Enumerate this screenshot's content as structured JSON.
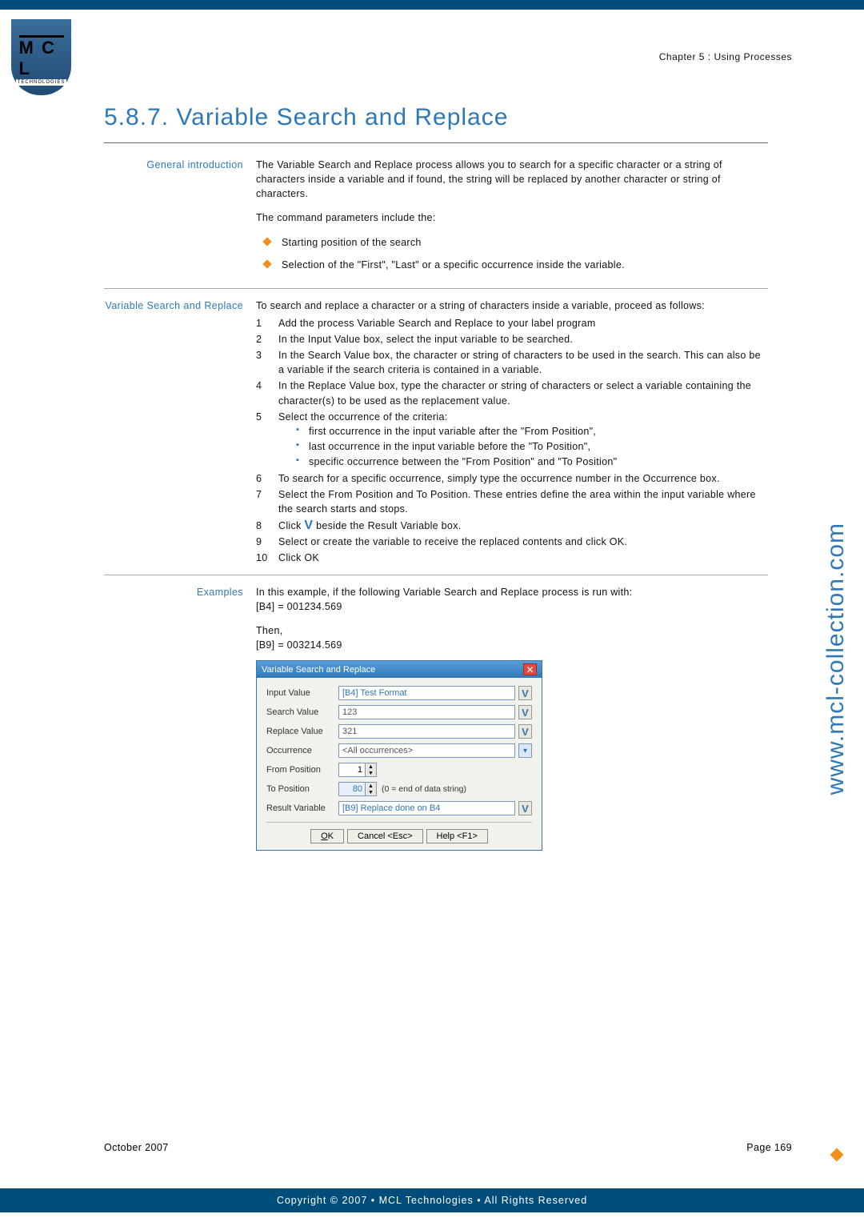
{
  "chapter": "Chapter 5 : Using Processes",
  "heading": "5.8.7.    Variable Search and Replace",
  "sections": {
    "intro": {
      "label": "General introduction",
      "p1": "The Variable Search and Replace process allows you to search for a specific character or a string of characters inside a variable and if found, the string will be replaced by another character or string of characters.",
      "p2": "The command parameters include the:",
      "bullets": [
        "Starting position of the search",
        "Selection of the \"First\", \"Last\" or a specific occurrence inside the variable."
      ]
    },
    "proc": {
      "label": "Variable Search and Replace",
      "lead": "To search and replace a character or a string of characters inside a variable, proceed as follows:",
      "steps": [
        "Add the process Variable Search and Replace to your label program",
        "In the Input Value box, select the input variable to be searched.",
        "In the Search Value box, the character or string of characters to be used in the search. This can also be a variable if the search criteria is contained in a variable.",
        "In the Replace Value box, type the character or string of characters or select a variable containing the character(s) to be used as the replacement value.",
        "Select the occurrence of the criteria:",
        "To search for a specific occurrence, simply type the occurrence number in the Occurrence box.",
        "Select the From Position and To Position. These entries define the area within the input variable where the search starts and stops.",
        "Click  beside the Result Variable box.",
        "Select or create the variable to receive the replaced contents and click OK.",
        "Click OK"
      ],
      "sub5": [
        "first occurrence in the input variable after the \"From Position\",",
        "last occurrence in the input variable before the \"To Position\",",
        "specific occurrence between the \"From Position\" and \"To Position\""
      ]
    },
    "examples": {
      "label": "Examples",
      "p1": "In this example, if the following Variable Search and Replace process is run with:",
      "eq1": "[B4] = 001234.569",
      "p2": "Then,",
      "eq2": "[B9] = 003214.569"
    }
  },
  "dialog": {
    "title": "Variable Search and Replace",
    "rows": {
      "input_label": "Input Value",
      "input_value": "[B4] Test Format",
      "search_label": "Search Value",
      "search_value": "123",
      "replace_label": "Replace Value",
      "replace_value": "321",
      "occurrence_label": "Occurrence",
      "occurrence_value": "<All occurrences>",
      "from_label": "From Position",
      "from_value": "1",
      "to_label": "To Position",
      "to_value": "80",
      "to_note": "(0 = end of data string)",
      "result_label": "Result Variable",
      "result_value": "[B9] Replace done on B4"
    },
    "buttons": {
      "ok": "OK",
      "cancel": "Cancel <Esc>",
      "help": "Help <F1>"
    }
  },
  "footer": {
    "date": "October 2007",
    "page": "Page 169",
    "copyright": "Copyright © 2007 • MCL Technologies • All Rights Reserved"
  },
  "side_url": "www.mcl-collection.com",
  "logo": {
    "mcl": "M C L",
    "tech": "TECHNOLOGIES"
  }
}
